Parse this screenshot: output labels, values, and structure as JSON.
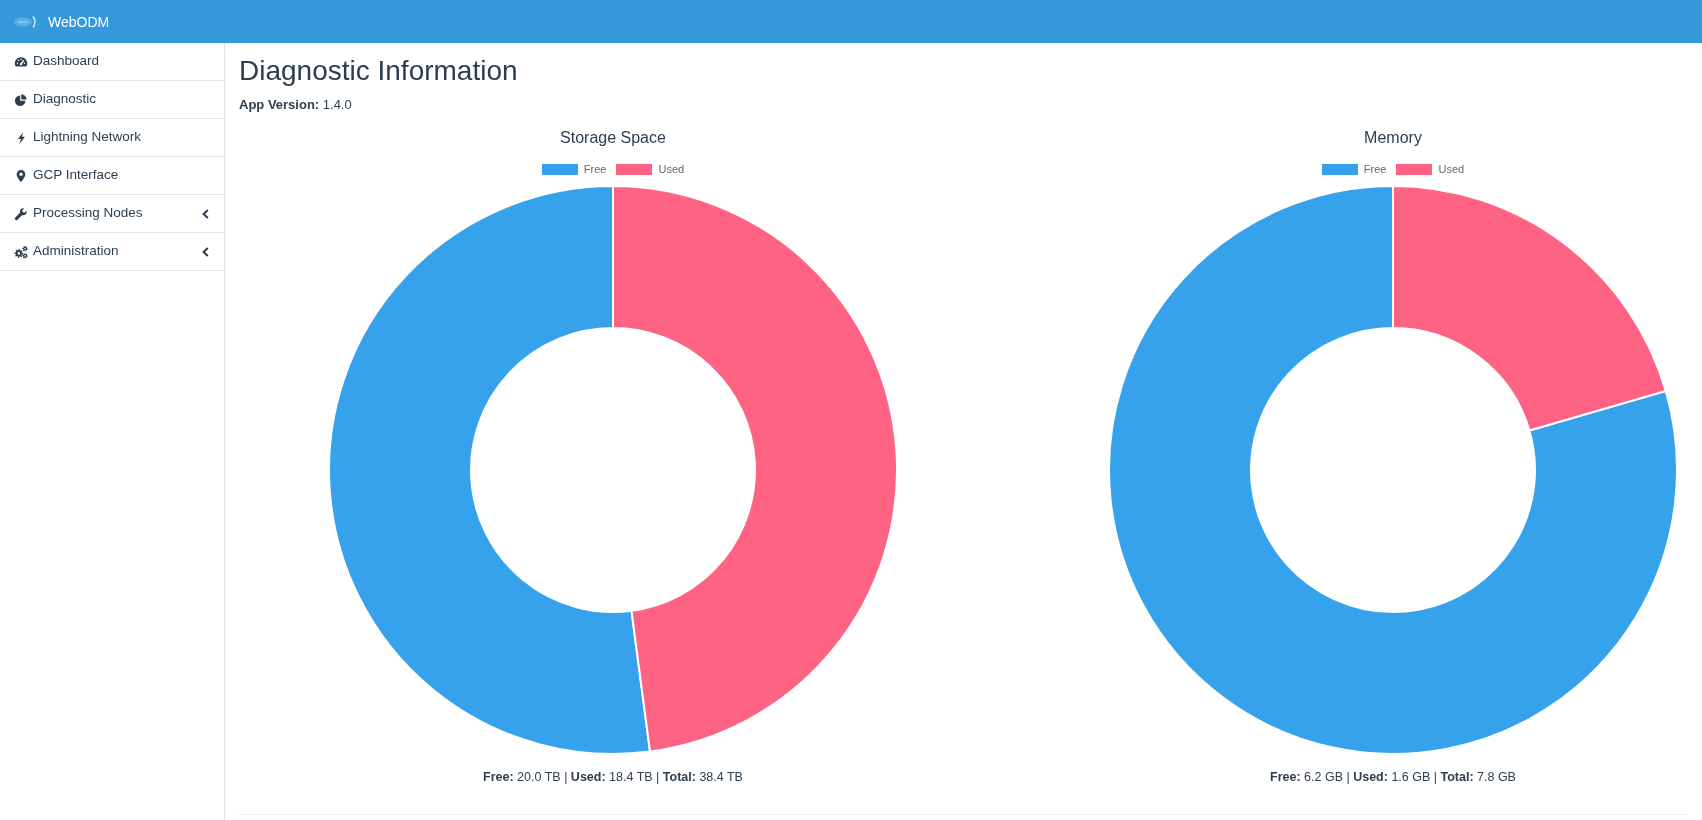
{
  "header": {
    "title": "WebODM"
  },
  "sidebar": {
    "items": [
      {
        "label": "Dashboard",
        "kind": "link"
      },
      {
        "label": "Diagnostic",
        "kind": "link"
      },
      {
        "label": "Lightning Network",
        "kind": "link"
      },
      {
        "label": "GCP Interface",
        "kind": "link"
      },
      {
        "label": "Processing Nodes",
        "kind": "menu"
      },
      {
        "label": "Administration",
        "kind": "menu"
      }
    ]
  },
  "page": {
    "title": "Diagnostic Information",
    "app_version": "**App Version:** 1.4.0"
  },
  "charts": [
    {
      "chart_data": {
        "type": "donut",
        "title": "Storage Space",
        "categories": [
          "Free",
          "Used"
        ],
        "values": [
          52.08,
          47.92
        ],
        "legend": "top"
      },
      "slices": [
        {
          "color": "#36a2eb"
        },
        {
          "color": "#ff6384"
        }
      ],
      "summary": "**Free:** 20.0 TB | **Used:** 18.4 TB | **Total:** 38.4 TB"
    },
    {
      "chart_data": {
        "type": "donut",
        "title": "Memory",
        "categories": [
          "Free",
          "Used"
        ],
        "values": [
          79.49,
          20.51
        ],
        "legend": "top"
      },
      "slices": [
        {
          "color": "#36a2eb"
        },
        {
          "color": "#ff6384"
        }
      ],
      "summary": "**Free:** 6.2 GB | **Used:** 1.6 GB | **Total:** 7.8 GB"
    }
  ]
}
